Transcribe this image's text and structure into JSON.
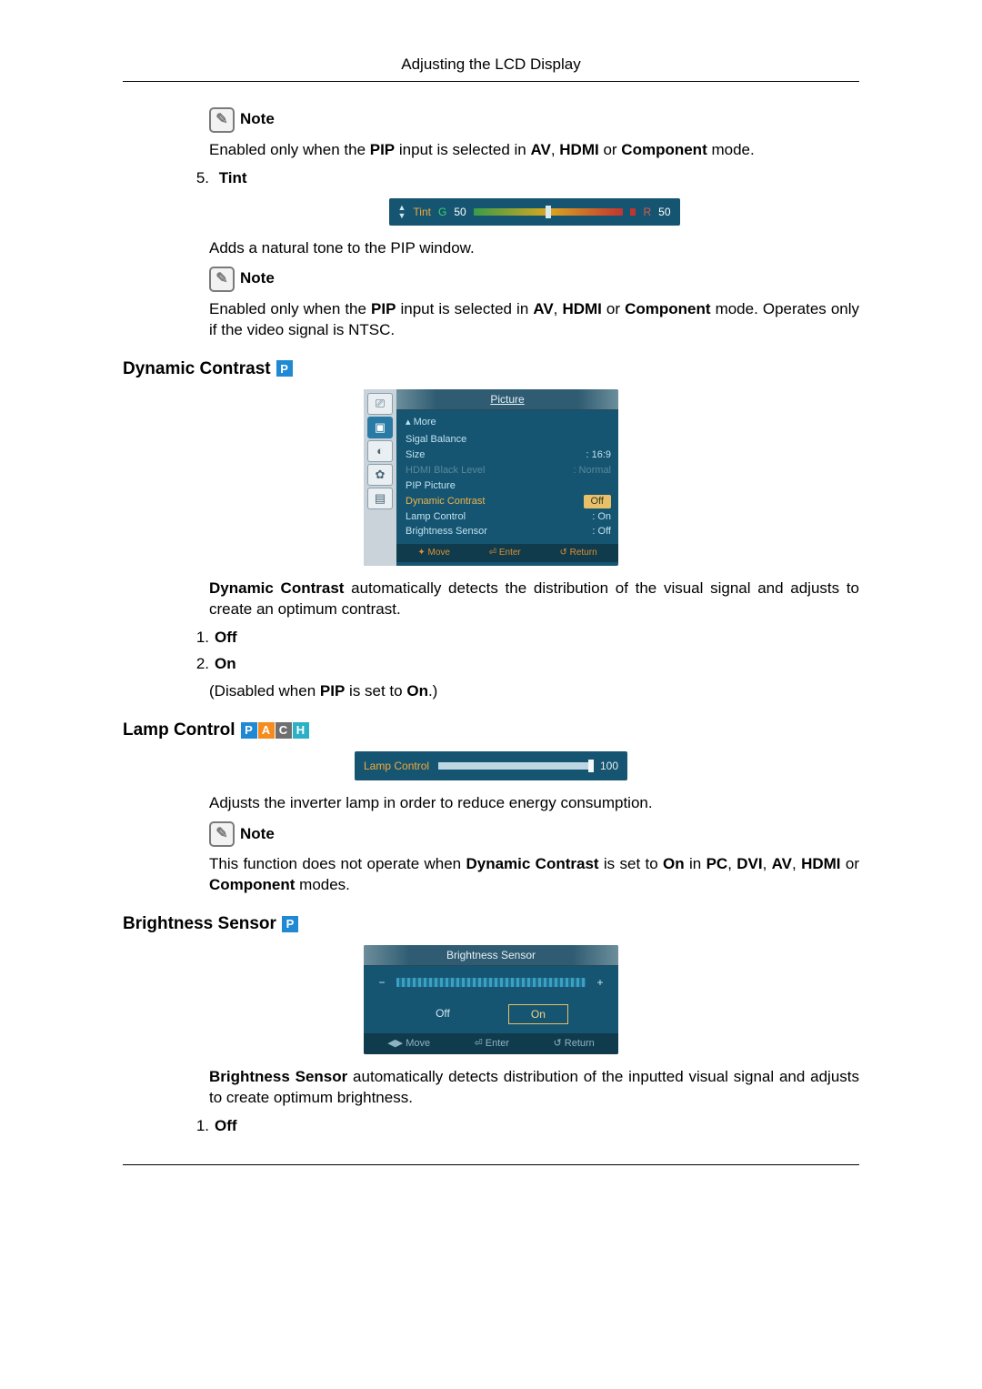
{
  "header": {
    "title": "Adjusting the LCD Display"
  },
  "note_label": "Note",
  "section1": {
    "note1_text_pre": "Enabled only when the ",
    "note1_b1": "PIP",
    "note1_mid1": " input is selected in ",
    "note1_b2": "AV",
    "note1_mid2": ", ",
    "note1_b3": "HDMI",
    "note1_mid3": " or ",
    "note1_b4": "Component",
    "note1_post": " mode.",
    "item5_num": "5.",
    "item5_label": "Tint",
    "tint_desc": "Adds a natural tone to the PIP window.",
    "note2_text_pre": "Enabled only when the ",
    "note2_b1": "PIP",
    "note2_mid1": " input is selected in ",
    "note2_b2": "AV",
    "note2_mid2": ", ",
    "note2_b3": "HDMI",
    "note2_mid3": " or ",
    "note2_b4": "Component",
    "note2_post": " mode. Operates only if the video signal is NTSC."
  },
  "tint_osd": {
    "label": "Tint",
    "g_label": "G",
    "g_value": "50",
    "r_label": "R",
    "r_value": "50"
  },
  "dc": {
    "heading": "Dynamic Contrast",
    "desc_b": "Dynamic Contrast",
    "desc_rest": " automatically detects the distribution of the visual signal and adjusts to create an optimum contrast.",
    "opt1_num": "1.",
    "opt1": "Off",
    "opt2_num": "2.",
    "opt2": "On",
    "disabled_pre": "(Disabled when ",
    "disabled_b1": "PIP",
    "disabled_mid": " is set to ",
    "disabled_b2": "On",
    "disabled_post": ".)"
  },
  "picture_menu": {
    "title": "Picture",
    "more": "▴ More",
    "rows": [
      {
        "k": "Sigal Balance",
        "v": ""
      },
      {
        "k": "Size",
        "v": "16:9"
      },
      {
        "k": "HDMI Black Level",
        "v": "Normal",
        "dim": true
      },
      {
        "k": "PIP Picture",
        "v": ""
      },
      {
        "k": "Dynamic Contrast",
        "v": "Off",
        "sel": true
      },
      {
        "k": "Lamp Control",
        "v": "On"
      },
      {
        "k": "Brightness Sensor",
        "v": "Off"
      }
    ],
    "foot": {
      "move": "Move",
      "enter": "Enter",
      "return": "Return"
    }
  },
  "lc": {
    "heading": "Lamp Control",
    "desc": "Adjusts the inverter lamp in order to reduce energy consumption.",
    "note_pre": "This function does not operate when ",
    "note_b1": "Dynamic Contrast",
    "note_mid1": " is set to ",
    "note_b2": "On",
    "note_mid2": " in ",
    "note_b3": "PC",
    "note_mid3": ", ",
    "note_b4": "DVI",
    "note_mid4": ", ",
    "note_b5": "AV",
    "note_mid5": ", ",
    "note_b6": "HDMI",
    "note_mid6": " or ",
    "note_b7": "Component",
    "note_post": " modes."
  },
  "lamp_osd": {
    "label": "Lamp Control",
    "value": "100"
  },
  "bs": {
    "heading": "Brightness Sensor",
    "desc_b": "Brightness Sensor",
    "desc_rest": " automatically detects distribution of the inputted visual signal and adjusts to create optimum brightness.",
    "opt1_num": "1.",
    "opt1": "Off"
  },
  "bs_osd": {
    "title": "Brightness Sensor",
    "off": "Off",
    "on": "On",
    "foot": {
      "move": "Move",
      "enter": "Enter",
      "return": "Return"
    }
  },
  "badges": {
    "p": "P",
    "a": "A",
    "c": "C",
    "h": "H"
  }
}
